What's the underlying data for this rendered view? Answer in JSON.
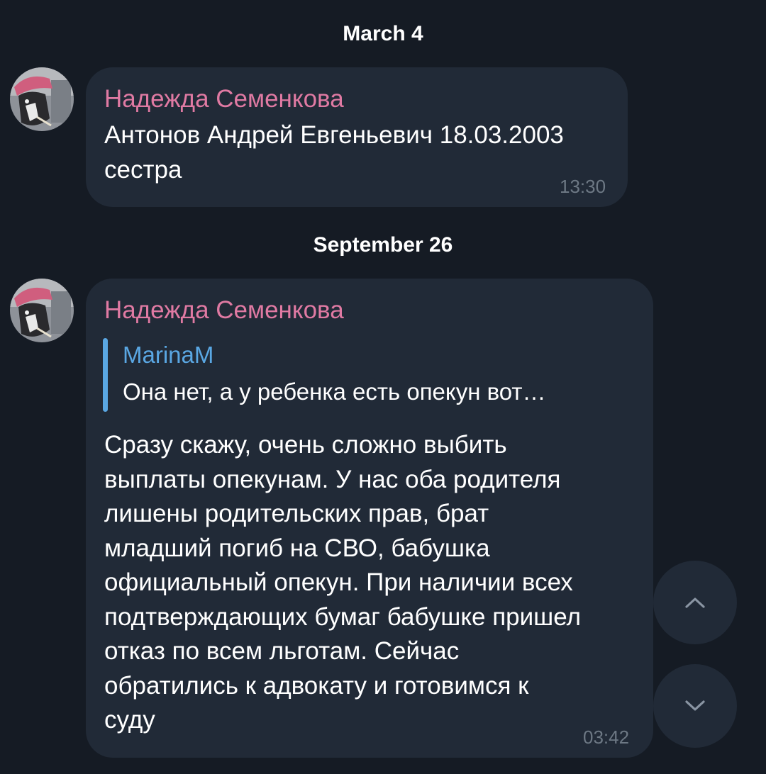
{
  "dates": [
    "March 4",
    "September 26"
  ],
  "messages": [
    {
      "sender": "Надежда Семенкова",
      "lines": [
        "Антонов Андрей Евгеньевич 18.03.2003",
        "сестра"
      ],
      "time": "13:30"
    },
    {
      "sender": "Надежда Семенкова",
      "reply": {
        "name": "MarinaM",
        "text": "Она нет, а у ребенка есть опекун вот…"
      },
      "lines": [
        "Сразу скажу, очень сложно выбить",
        "выплаты опекунам. У нас оба родителя",
        "лишены родительских прав, брат",
        "младший погиб на СВО, бабушка",
        "официальный опекун. При наличии всех",
        "подтверждающих бумаг бабушке пришел",
        "отказ по всем льготам. Сейчас",
        "обратились к адвокату и готовимся к",
        "суду"
      ],
      "time": "03:42"
    }
  ],
  "controls": {
    "scroll_up_icon": "chevron-up-icon",
    "scroll_down_icon": "chevron-down-icon"
  },
  "colors": {
    "background": "#151b24",
    "bubble": "#212a37",
    "sender": "#e07aa3",
    "reply_accent": "#5aa7e3",
    "time": "#6d7884"
  }
}
